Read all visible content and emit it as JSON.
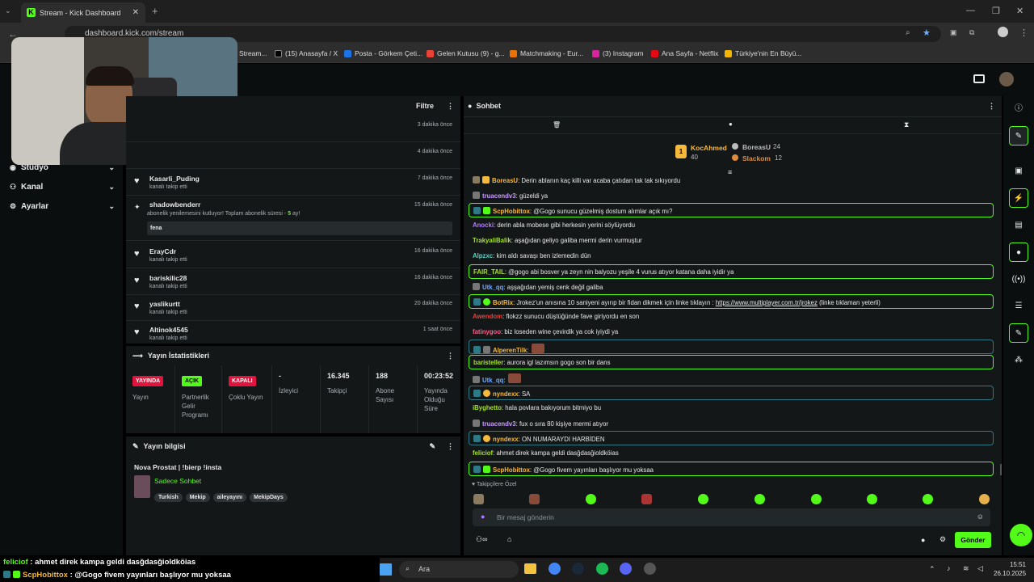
{
  "browser": {
    "tab_title": "Stream - Kick Dashboard",
    "url": "dashboard.kick.com/stream",
    "bookmarks": [
      "Stream...",
      "(15) Anasayfa / X",
      "Posta - Görkem Çeti...",
      "Gelen Kutusu (9) - g...",
      "Matchmaking - Eur...",
      "(3) Instagram",
      "Ana Sayfa - Netflix",
      "Türkiye'nin En Büyü..."
    ]
  },
  "nav": {
    "items": [
      {
        "label": "Stüdyo"
      },
      {
        "label": "Kanal"
      },
      {
        "label": "Ayarlar"
      }
    ]
  },
  "feed": {
    "filter_label": "Filtre",
    "rows": [
      {
        "time": "3 dakika önce"
      },
      {
        "time": "4 dakika önce"
      },
      {
        "name": "Kasarli_Puding",
        "sub": "kanalı takip etti",
        "time": "7 dakika önce"
      },
      {
        "name": "shadowbenderr",
        "sub_prefix": "abonelik yenilemesini kutluyor! Toplam abonelik süresi - ",
        "sub_count": "5",
        "sub_suffix": " ay!",
        "time": "15 dakika önce",
        "message": "fena"
      },
      {
        "name": "ErayCdr",
        "sub": "kanalı takip etti",
        "time": "16 dakika önce"
      },
      {
        "name": "bariskilic28",
        "sub": "kanalı takip etti",
        "time": "16 dakika önce"
      },
      {
        "name": "yaslikurtt",
        "sub": "kanalı takip etti",
        "time": "20 dakika önce"
      },
      {
        "name": "Altinok4545",
        "sub": "kanalı takip etti",
        "time": "1 saat önce"
      }
    ]
  },
  "stats": {
    "title": "Yayın İstatistikleri",
    "cells": [
      {
        "pill": "YAYINDA",
        "label": "Yayın"
      },
      {
        "pill": "AÇIK",
        "label": "Partnerlik Gelir Programı"
      },
      {
        "pill": "KAPALI",
        "label": "Çoklu Yayın"
      },
      {
        "value": "-",
        "label": "İzleyici"
      },
      {
        "value": "16.345",
        "label": "Takipçi"
      },
      {
        "value": "188",
        "label": "Abone Sayısı"
      },
      {
        "value": "00:23:52",
        "label": "Yayında Olduğu Süre"
      }
    ]
  },
  "info": {
    "title": "Yayın bilgisi",
    "stream_title": "Nova Prostat | !bierp !insta",
    "category": "Sadece Sohbet",
    "tags": [
      "Turkish",
      "Mekip",
      "aileyayını",
      "MekipDays"
    ]
  },
  "chat": {
    "title": "Sohbet",
    "leaderboard": {
      "first": {
        "rank": "1",
        "name": "KocAhmed",
        "count": "40"
      },
      "second": {
        "name": "BoreasU",
        "count": "24"
      },
      "third": {
        "name": "Slackom",
        "count": "12"
      }
    },
    "messages": [
      {
        "user": "BoreasU",
        "color": "#f6b93b",
        "text": ": Derin ablanın kaç killi var acaba çatıdan tak tak sıkıyordu",
        "style": ""
      },
      {
        "user": "truacendv3",
        "color": "#c89bff",
        "text": ": güzeldi ya",
        "style": ""
      },
      {
        "user": "ScpHobittox",
        "color": "#f6b93b",
        "text": ": @Gogo sunucu güzelmiş dostum alımlar açık mı?",
        "style": "hl"
      },
      {
        "user": "Anocki",
        "color": "#b07cff",
        "text": ": derin abla mobese gibi herkesin yerini söylüyordu",
        "style": ""
      },
      {
        "user": "TrakyaliBalik",
        "color": "#a6e22e",
        "text": ": aşağıdan geliyo galiba mermi derin vurmuştur",
        "style": ""
      },
      {
        "user": "Alpzxc",
        "color": "#5ad1c4",
        "text": ": kim aldı savaşı ben izlemedin dün",
        "style": ""
      },
      {
        "user": "FAIR_TAIL",
        "color": "#a6e22e",
        "text": ": @gogo abi bosver ya zeyn nin balyozu yeşile 4 vurus atıyor katana daha iyidir ya",
        "style": "hl"
      },
      {
        "user": "Utk_qq",
        "color": "#6fa8ff",
        "text": ": aşşağıdan yemiş cenk değil galiba",
        "style": ""
      },
      {
        "user": "BotRix",
        "color": "#f6b93b",
        "text": ": Jrokez'un anısına 10 saniyeni ayırıp bir fidan dikmek için linke tıklayın : ",
        "link": "https://www.multiplayer.com.tr/jrokez",
        "tail": " (linke tıklaman yeterli)",
        "style": "hl"
      },
      {
        "user": "Awendom",
        "color": "#e0443e",
        "text": ": flokzz sunucu düştüğünde fave giriyordu en son",
        "style": ""
      },
      {
        "user": "fatinygoo",
        "color": "#ff5c8a",
        "text": ": biz loseden wine çevirdik ya cok iyiydi ya",
        "style": ""
      },
      {
        "user": "AlperenTilk",
        "color": "#f6b93b",
        "text": ":",
        "style": "hb"
      },
      {
        "user": "baristeller",
        "color": "#a6e22e",
        "text": ": aurora igl lazımsın gogo son bir dans",
        "style": "hl"
      },
      {
        "user": "Utk_qq",
        "color": "#6fa8ff",
        "text": ":",
        "style": ""
      },
      {
        "user": "nyndexx",
        "color": "#f6b93b",
        "text": ": SA",
        "style": "hb"
      },
      {
        "user": "iByghetto",
        "color": "#a6e22e",
        "text": ": hala povlara bakıyorum bitmiyo bu",
        "style": ""
      },
      {
        "user": "truacendv3",
        "color": "#c89bff",
        "text": ": fux o sıra 80 kişiye mermi atıyor",
        "style": ""
      },
      {
        "user": "nyndexx",
        "color": "#f6b93b",
        "text": ": ON NUMARAYDI HARBİDEN",
        "style": "hb"
      },
      {
        "user": "feliciof",
        "color": "#a6e22e",
        "text": ": ahmet direk kampa geldi dasğdasğioldköias",
        "style": ""
      },
      {
        "user": "ScpHobittox",
        "color": "#f6b93b",
        "text": ": @Gogo fivem yayınları başlıyor mu yoksaa",
        "style": "hl"
      }
    ],
    "followers_only": "Takipçilere Özel",
    "input_placeholder": "Bir mesaj gönderin",
    "send_label": "Gönder"
  },
  "ticker": [
    {
      "user": "feliciof",
      "text": " : ahmet direk kampa geldi dasğdasğioldköias"
    },
    {
      "user": "ScpHobittox",
      "text": " : @Gogo fivem yayınları başlıyor mu yoksaa"
    }
  ],
  "taskbar": {
    "search": "Ara",
    "time": "15:51",
    "date": "26.10.2025"
  },
  "colors": {
    "accent": "#53fc18",
    "live": "#e0143c",
    "panel": "#141718"
  }
}
